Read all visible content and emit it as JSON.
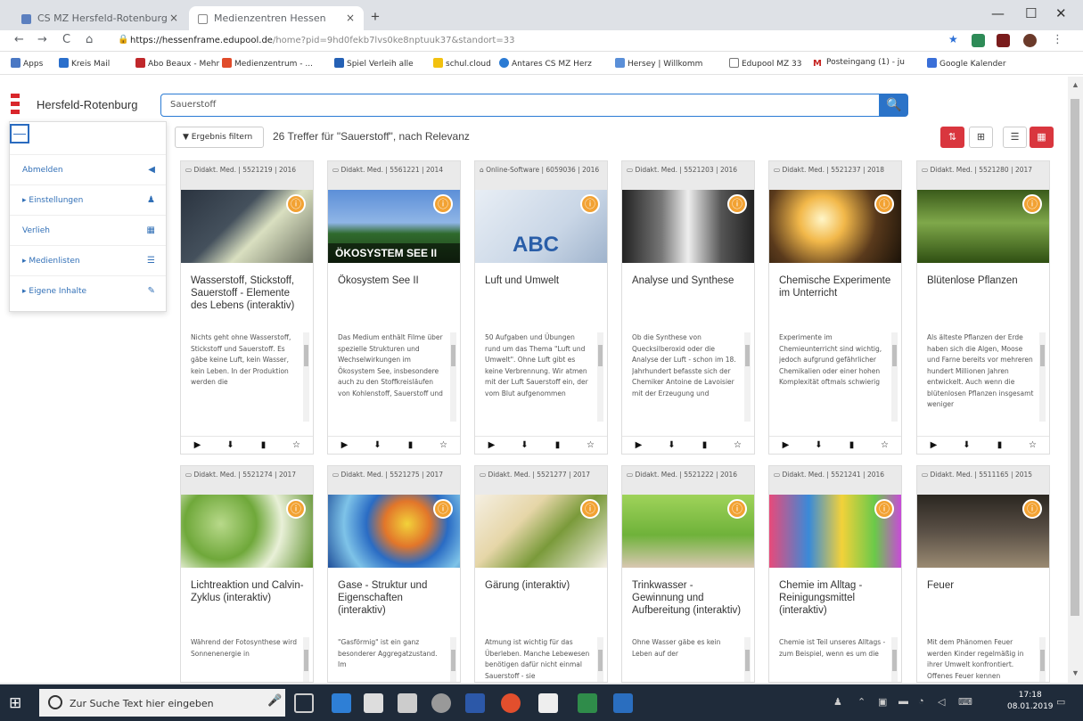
{
  "browser": {
    "tabs": [
      {
        "title": "CS MZ Hersfeld-Rotenburg",
        "close": "×"
      },
      {
        "title": "Medienzentren Hessen",
        "close": "×"
      }
    ],
    "new_tab": "+",
    "window_controls": {
      "minimize": "—",
      "maximize": "☐",
      "close": "✕"
    },
    "nav": {
      "back": "←",
      "forward": "→",
      "reload": "C",
      "home": "⌂"
    },
    "url_host": "https://hessenframe.edupool.de",
    "url_path": "/home?pid=9hd0fekb7lvs0ke8nptuuk37&standort=33",
    "bookmarks": [
      "Apps",
      "Kreis Mail",
      "Abo Beaux - Mehr",
      "Medienzentrum - ...",
      "Spiel Verleih alle",
      "schul.cloud",
      "Antares CS MZ Herz",
      "Hersey | Willkomm",
      "Edupool MZ 33",
      "Posteingang (1) - ju",
      "Google Kalender"
    ]
  },
  "header": {
    "brand": "Hersfeld-Rotenburg",
    "search_value": "Sauerstoff",
    "search_icon": "search-icon"
  },
  "sidebar": {
    "collapse": "—",
    "items": [
      {
        "label": "Abmelden",
        "icon": "◀",
        "icon_name": "logout-icon"
      },
      {
        "label": "▸ Einstellungen",
        "icon": "♟",
        "icon_name": "user-icon"
      },
      {
        "label": "Verlieh",
        "icon": "▦",
        "icon_name": "calendar-icon"
      },
      {
        "label": "▸ Medienlisten",
        "icon": "☰",
        "icon_name": "list-icon"
      },
      {
        "label": "▸ Eigene Inhalte",
        "icon": "✎",
        "icon_name": "edit-icon"
      }
    ]
  },
  "results": {
    "filter_label": "▼ Ergebnis filtern",
    "summary": "26 Treffer für \"Sauerstoff\", nach Relevanz",
    "view_buttons": [
      "⇅",
      "⊞",
      "☰",
      "▦"
    ]
  },
  "actions": {
    "play": "▶",
    "download": "⬇",
    "doc": "▮",
    "star": "☆"
  },
  "cards": [
    {
      "meta": "Didakt. Med. | 5521219 | 2016",
      "title": "Wasserstoff, Stickstoff, Sauerstoff - Elemente des Lebens (interaktiv)",
      "desc": "Nichts geht ohne Wasserstoff, Stickstoff und Sauerstoff. Es gäbe keine Luft, kein Wasser, kein Leben. In der Produktion werden die",
      "thumb": "t-smoke"
    },
    {
      "meta": "Didakt. Med. | 5561221 | 2014",
      "title": "Ökosystem See II",
      "desc": "Das Medium enthält Filme über spezielle Strukturen und Wechselwirkungen im Ökosystem See, insbesondere auch zu den Stoffkreisläufen von Kohlenstoff, Sauerstoff und",
      "thumb": "t-see",
      "thumb_text": "ÖKOSYSTEM SEE II"
    },
    {
      "meta": "Online-Software | 6059036 | 2016",
      "title": "Luft und Umwelt",
      "desc": "50 Aufgaben und Übungen rund um das Thema \"Luft und Umwelt\". Ohne Luft gibt es keine Verbrennung. Wir atmen mit der Luft Sauerstoff ein, der vom Blut aufgenommen",
      "thumb": "t-abc",
      "thumb_text": "ABC"
    },
    {
      "meta": "Didakt. Med. | 5521203 | 2016",
      "title": "Analyse und Synthese",
      "desc": "Ob die Synthese von Quecksilberoxid oder die Analyse der Luft - schon im 18. Jahrhundert befasste sich der Chemiker Antoine de Lavoisier mit der Erzeugung und",
      "thumb": "t-lab"
    },
    {
      "meta": "Didakt. Med. | 5521237 | 2018",
      "title": "Chemische Experimente im Unterricht",
      "desc": "Experimente im Chemieunterricht sind wichtig, jedoch aufgrund gefährlicher Chemikalien oder einer hohen Komplexität oftmals schwierig",
      "thumb": "t-spark"
    },
    {
      "meta": "Didakt. Med. | 5521280 | 2017",
      "title": "Blütenlose Pflanzen",
      "desc": "Als älteste Pflanzen der Erde haben sich die Algen, Moose und Farne bereits vor mehreren hundert Millionen Jahren entwickelt. Auch wenn die blütenlosen Pflanzen insgesamt weniger",
      "thumb": "t-fern"
    },
    {
      "meta": "Didakt. Med. | 5521274 | 2017",
      "title": "Lichtreaktion und Calvin-Zyklus (interaktiv)",
      "desc": "Während der Fotosynthese wird Sonnenenergie in",
      "thumb": "t-leaves"
    },
    {
      "meta": "Didakt. Med. | 5521275 | 2017",
      "title": "Gase - Struktur und Eigenschaften (interaktiv)",
      "desc": "\"Gasförmig\" ist ein ganz besonderer Aggregatzustand. Im",
      "thumb": "t-balloon"
    },
    {
      "meta": "Didakt. Med. | 5521277 | 2017",
      "title": "Gärung (interaktiv)",
      "desc": "Atmung ist wichtig für das Überleben. Manche Lebewesen benötigen dafür nicht einmal Sauerstoff - sie",
      "thumb": "t-food"
    },
    {
      "meta": "Didakt. Med. | 5521222 | 2016",
      "title": "Trinkwasser - Gewinnung und Aufbereitung (interaktiv)",
      "desc": "Ohne Wasser gäbe es kein Leben auf der",
      "thumb": "t-water"
    },
    {
      "meta": "Didakt. Med. | 5521241 | 2016",
      "title": "Chemie im Alltag - Reinigungsmittel (interaktiv)",
      "desc": "Chemie ist Teil unseres Alltags - zum Beispiel, wenn es um die",
      "thumb": "t-clean"
    },
    {
      "meta": "Didakt. Med. | 5511165 | 2015",
      "title": "Feuer",
      "desc": "Mit dem Phänomen Feuer werden Kinder regelmäßig in ihrer Umwelt konfrontiert. Offenes Feuer kennen",
      "thumb": "t-fire"
    }
  ],
  "taskbar": {
    "search_placeholder": "Zur Suche Text hier eingeben",
    "time": "17:18",
    "date": "08.01.2019"
  }
}
